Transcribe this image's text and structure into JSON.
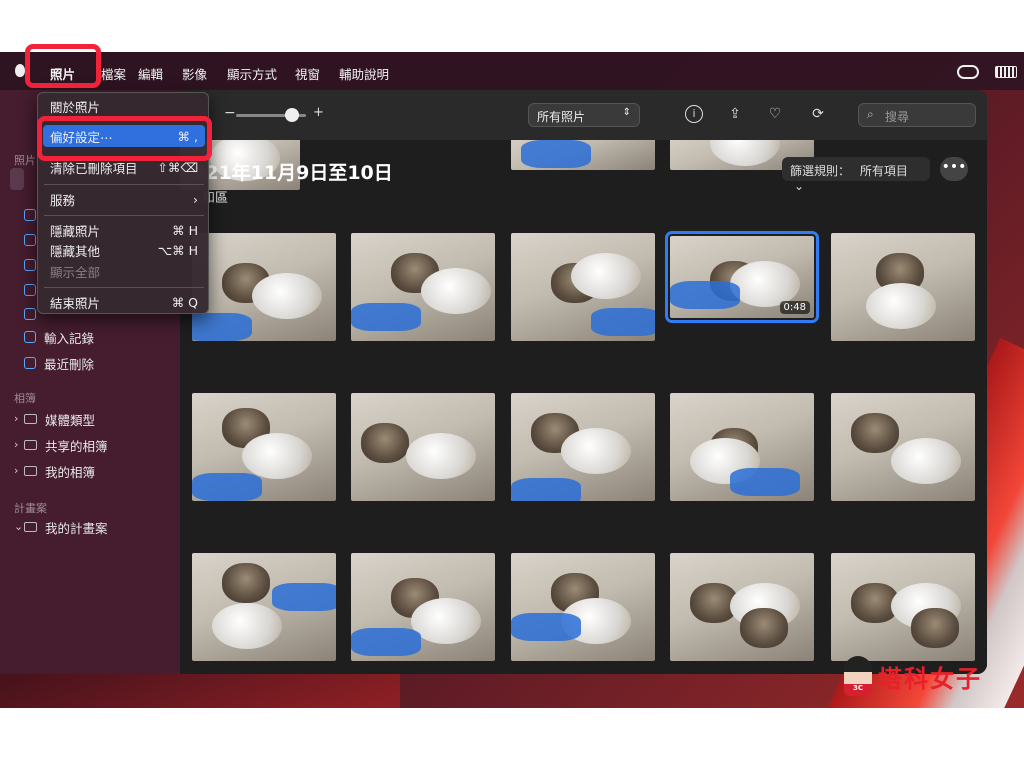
{
  "menubar": {
    "items": [
      "照片",
      "檔案",
      "編輯",
      "影像",
      "顯示方式",
      "視窗",
      "輔助說明"
    ]
  },
  "dropdown": {
    "items": [
      {
        "label": "關於照片",
        "shortcut": ""
      },
      {
        "label": "偏好設定⋯",
        "shortcut": "⌘ ,"
      },
      {
        "label": "清除已刪除項目",
        "shortcut": "⇧⌘⌫"
      },
      {
        "label": "服務",
        "shortcut": "›"
      },
      {
        "label": "隱藏照片",
        "shortcut": "⌘ H"
      },
      {
        "label": "隱藏其他",
        "shortcut": "⌥⌘ H"
      },
      {
        "label": "顯示全部",
        "shortcut": ""
      },
      {
        "label": "結束照片",
        "shortcut": "⌘ Q"
      }
    ]
  },
  "sidebar": {
    "section_library": "照片",
    "items": [
      "輸入記錄",
      "最近刪除"
    ],
    "section_albums": "相簿",
    "albums": [
      "媒體類型",
      "共享的相簿",
      "我的相簿"
    ],
    "section_projects": "計畫案",
    "projects": [
      "我的計畫案"
    ]
  },
  "toolbar": {
    "zoom_minus": "−",
    "zoom_plus": "+",
    "view_select": "所有照片",
    "search_placeholder": "搜尋"
  },
  "content": {
    "date_title": "021年11月9日至10日",
    "location": "和區",
    "filter_label": "篩選規則：",
    "filter_value": "所有項目",
    "more": "•••",
    "video_duration": "0:48"
  },
  "watermark": {
    "text": "塔科女子",
    "badge": "3C"
  },
  "colors": {
    "highlight": "#f2223a",
    "selection": "#2f6fde"
  }
}
